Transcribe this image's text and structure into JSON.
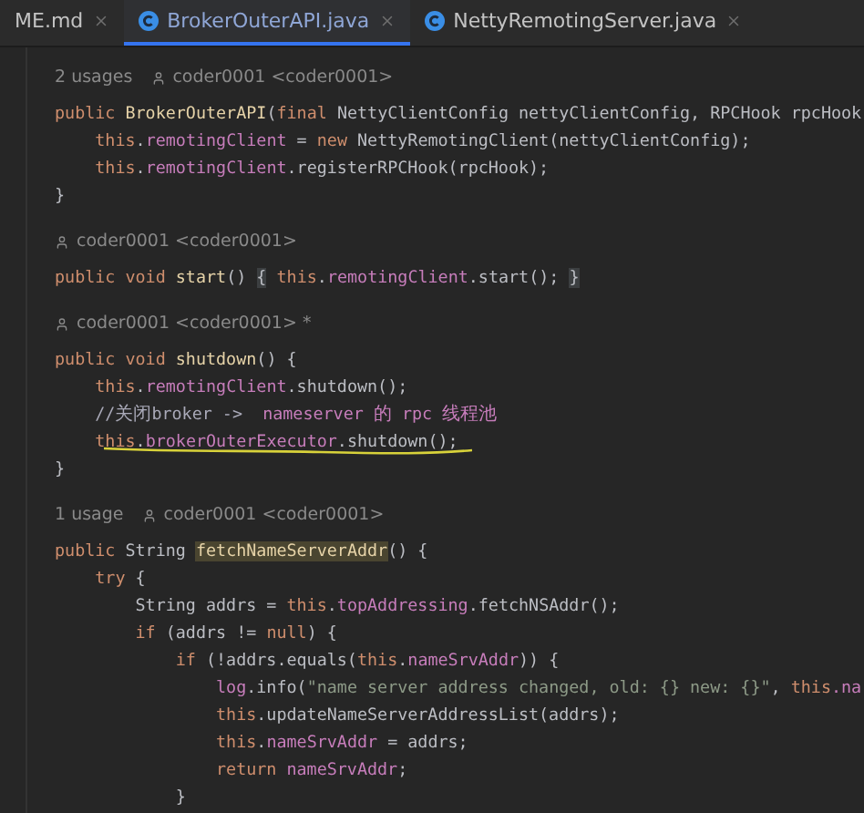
{
  "tabs": [
    {
      "label": "ME.md",
      "kind": "markdown",
      "selected": false
    },
    {
      "label": "BrokerOuterAPI.java",
      "kind": "java",
      "selected": true
    },
    {
      "label": "NettyRemotingServer.java",
      "kind": "java",
      "selected": false
    }
  ],
  "lines": [
    {
      "kind": "hint",
      "usages": "2 usages",
      "author": "coder0001 <coder0001>"
    },
    {
      "kind": "code",
      "underlined": false,
      "tokens": [
        {
          "text": "public ",
          "kind": "kw"
        },
        {
          "text": "BrokerOuterAPI",
          "kind": "dc"
        },
        {
          "text": "(",
          "kind": "pl"
        },
        {
          "text": "final ",
          "kind": "kw"
        },
        {
          "text": "NettyClientConfig nettyClientConfig, RPCHook rpcHook",
          "kind": "pl"
        }
      ]
    },
    {
      "kind": "code",
      "underlined": false,
      "tokens": [
        {
          "text": "    this",
          "kind": "kw"
        },
        {
          "text": ".",
          "kind": "pl"
        },
        {
          "text": "remotingClient",
          "kind": "fd"
        },
        {
          "text": " = ",
          "kind": "pl"
        },
        {
          "text": "new ",
          "kind": "kw"
        },
        {
          "text": "NettyRemotingClient(nettyClientConfig);",
          "kind": "pl"
        }
      ]
    },
    {
      "kind": "code",
      "underlined": false,
      "tokens": [
        {
          "text": "    this",
          "kind": "kw"
        },
        {
          "text": ".",
          "kind": "pl"
        },
        {
          "text": "remotingClient",
          "kind": "fd"
        },
        {
          "text": ".registerRPCHook(rpcHook);",
          "kind": "pl"
        }
      ]
    },
    {
      "kind": "code",
      "underlined": false,
      "tokens": [
        {
          "text": "}",
          "kind": "pl"
        }
      ]
    },
    {
      "kind": "blank"
    },
    {
      "kind": "hint",
      "author": "coder0001 <coder0001>"
    },
    {
      "kind": "code",
      "underlined": false,
      "tokens": [
        {
          "text": "public void ",
          "kind": "kw"
        },
        {
          "text": "start",
          "kind": "dc"
        },
        {
          "text": "() ",
          "kind": "pl"
        },
        {
          "text": "{",
          "kind": "br"
        },
        {
          "text": " this",
          "kind": "kw"
        },
        {
          "text": ".",
          "kind": "pl"
        },
        {
          "text": "remotingClient",
          "kind": "fd"
        },
        {
          "text": ".start(); ",
          "kind": "pl"
        },
        {
          "text": "}",
          "kind": "br"
        }
      ]
    },
    {
      "kind": "blank"
    },
    {
      "kind": "hint",
      "author": "coder0001 <coder0001> *"
    },
    {
      "kind": "code",
      "underlined": false,
      "tokens": [
        {
          "text": "public void ",
          "kind": "kw"
        },
        {
          "text": "shutdown",
          "kind": "dc"
        },
        {
          "text": "() {",
          "kind": "pl"
        }
      ]
    },
    {
      "kind": "code",
      "underlined": false,
      "tokens": [
        {
          "text": "    this",
          "kind": "kw"
        },
        {
          "text": ".",
          "kind": "pl"
        },
        {
          "text": "remotingClient",
          "kind": "fd"
        },
        {
          "text": ".shutdown();",
          "kind": "pl"
        }
      ]
    },
    {
      "kind": "code",
      "underlined": false,
      "tokens": [
        {
          "text": "    //关闭broker ->  ",
          "kind": "cm"
        },
        {
          "text": "nameserver 的 rpc 线程池",
          "kind": "cm2"
        }
      ]
    },
    {
      "kind": "code",
      "underlined": true,
      "tokens": [
        {
          "text": "    this",
          "kind": "kw"
        },
        {
          "text": ".",
          "kind": "pl"
        },
        {
          "text": "brokerOuterExecutor",
          "kind": "fd"
        },
        {
          "text": ".shutdown();",
          "kind": "pl"
        }
      ]
    },
    {
      "kind": "code",
      "underlined": false,
      "tokens": [
        {
          "text": "}",
          "kind": "pl"
        }
      ]
    },
    {
      "kind": "blank"
    },
    {
      "kind": "hint",
      "usages": "1 usage",
      "author": "coder0001 <coder0001>"
    },
    {
      "kind": "code",
      "underlined": false,
      "tokens": [
        {
          "text": "public ",
          "kind": "kw"
        },
        {
          "text": "String ",
          "kind": "pl"
        },
        {
          "text": "fetchNameServerAddr",
          "kind": "hl"
        },
        {
          "text": "() {",
          "kind": "pl"
        }
      ]
    },
    {
      "kind": "code",
      "underlined": false,
      "tokens": [
        {
          "text": "    try ",
          "kind": "kw"
        },
        {
          "text": "{",
          "kind": "pl"
        }
      ]
    },
    {
      "kind": "code",
      "underlined": false,
      "tokens": [
        {
          "text": "        String addrs = ",
          "kind": "pl"
        },
        {
          "text": "this",
          "kind": "kw"
        },
        {
          "text": ".",
          "kind": "pl"
        },
        {
          "text": "topAddressing",
          "kind": "fd"
        },
        {
          "text": ".fetchNSAddr();",
          "kind": "pl"
        }
      ]
    },
    {
      "kind": "code",
      "underlined": false,
      "tokens": [
        {
          "text": "        if ",
          "kind": "kw"
        },
        {
          "text": "(addrs != ",
          "kind": "pl"
        },
        {
          "text": "null",
          "kind": "kw"
        },
        {
          "text": ") {",
          "kind": "pl"
        }
      ]
    },
    {
      "kind": "code",
      "underlined": false,
      "tokens": [
        {
          "text": "            if ",
          "kind": "kw"
        },
        {
          "text": "(!addrs.equals(",
          "kind": "pl"
        },
        {
          "text": "this",
          "kind": "kw"
        },
        {
          "text": ".",
          "kind": "pl"
        },
        {
          "text": "nameSrvAddr",
          "kind": "fd"
        },
        {
          "text": ")) {",
          "kind": "pl"
        }
      ]
    },
    {
      "kind": "code",
      "underlined": false,
      "tokens": [
        {
          "text": "                log",
          "kind": "fd"
        },
        {
          "text": ".info(",
          "kind": "pl"
        },
        {
          "text": "\"name server address changed, old: {} new: {}\"",
          "kind": "st"
        },
        {
          "text": ", ",
          "kind": "pl"
        },
        {
          "text": "this",
          "kind": "kw"
        },
        {
          "text": ".na",
          "kind": "fd"
        }
      ]
    },
    {
      "kind": "code",
      "underlined": false,
      "tokens": [
        {
          "text": "                this",
          "kind": "kw"
        },
        {
          "text": ".updateNameServerAddressList(addrs);",
          "kind": "pl"
        }
      ]
    },
    {
      "kind": "code",
      "underlined": false,
      "tokens": [
        {
          "text": "                this",
          "kind": "kw"
        },
        {
          "text": ".",
          "kind": "pl"
        },
        {
          "text": "nameSrvAddr",
          "kind": "fd"
        },
        {
          "text": " = addrs;",
          "kind": "pl"
        }
      ]
    },
    {
      "kind": "code",
      "underlined": false,
      "tokens": [
        {
          "text": "                return ",
          "kind": "kw"
        },
        {
          "text": "nameSrvAddr",
          "kind": "fd"
        },
        {
          "text": ";",
          "kind": "pl"
        }
      ]
    },
    {
      "kind": "code",
      "underlined": false,
      "tokens": [
        {
          "text": "            }",
          "kind": "pl"
        }
      ]
    }
  ]
}
